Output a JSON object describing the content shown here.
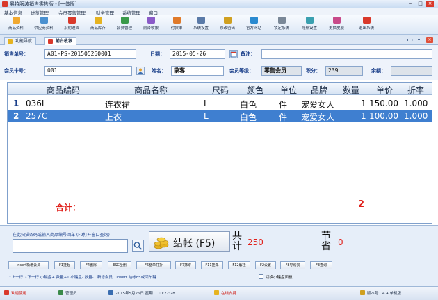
{
  "window": {
    "title": "易特服装销售零售版 - [一体版]",
    "minimize": "–",
    "maximize": "□",
    "close": "×"
  },
  "menu": [
    "基本信息",
    "进货管理",
    "会员零售管理",
    "财务管理",
    "系统管理",
    "窗口"
  ],
  "toolbar": [
    "商品资料",
    "供应商资料",
    "采购进货",
    "商品库存",
    "会员管理",
    "前台收银",
    "付款单",
    "系统设置",
    "修改密码",
    "官方网站",
    "锁定系统",
    "导航设置",
    "更换皮肤",
    "退出系统"
  ],
  "tabs": [
    {
      "label": "功能导航",
      "active": false
    },
    {
      "label": "前台收银",
      "active": true
    }
  ],
  "tab_controls": {
    "left": "◂",
    "right": "▸",
    "menu": "▾",
    "close": "×"
  },
  "form": {
    "sales_no_label": "销售单号：",
    "sales_no": "A01-PS-201505260001",
    "date_label": "日期：",
    "date": "2015-05-26",
    "remark_label": "备注：",
    "remark": "",
    "member_card_label": "会员卡号：",
    "member_card": "001",
    "name_label": "姓名：",
    "name": "散客",
    "level_label": "会员等级：",
    "level": "零售会员",
    "points_label": "积分：",
    "points": "239",
    "balance_label": "余额：",
    "balance": ""
  },
  "grid": {
    "columns": [
      "商品编码",
      "商品名称",
      "尺码",
      "颜色",
      "单位",
      "品牌",
      "数量",
      "单价",
      "折率"
    ],
    "rows": [
      {
        "no": "1",
        "code": "036L",
        "name": "连衣裙",
        "size": "L",
        "color": "白色",
        "unit": "件",
        "brand": "宠爱女人",
        "qty": "1",
        "price": "150.00",
        "rate": "1.000",
        "selected": false
      },
      {
        "no": "2",
        "code": "257C",
        "name": "上衣",
        "size": "L",
        "color": "白色",
        "unit": "件",
        "brand": "宠爱女人",
        "qty": "1",
        "price": "100.00",
        "rate": "1.000",
        "selected": true
      }
    ],
    "total_label": "合计：",
    "total_qty": "2"
  },
  "bottom": {
    "hint": "在此扫描条码或输入商品编号回车 (F9打开窗口查询)",
    "scan_value": "",
    "checkout_label": "结帐 (F5)",
    "total_label": "共计",
    "total_value": "250",
    "save_label": "节省",
    "save_value": "0",
    "function_keys": [
      "Insert新增会员",
      "F1挂起",
      "F4删除",
      "ESC全删",
      "F6整单打折",
      "F7抹零",
      "F11挂单",
      "F12解挂",
      "F2设置",
      "F8导购员",
      "F3查询"
    ],
    "shortcuts": "↑上一行    ↓下一行    小键盘+ 数量+1   小键盘- 数量-1   新增会员：Insert   结帐F5或回车键",
    "switch_keyboard_label": "切换小键盘面板"
  },
  "status": {
    "left": "欢迎使用",
    "user": "管理员",
    "datetime": "2015年5月26日  星期二    10:22:28",
    "support": "在线支持",
    "version": "版本号：4.4 单机版"
  }
}
